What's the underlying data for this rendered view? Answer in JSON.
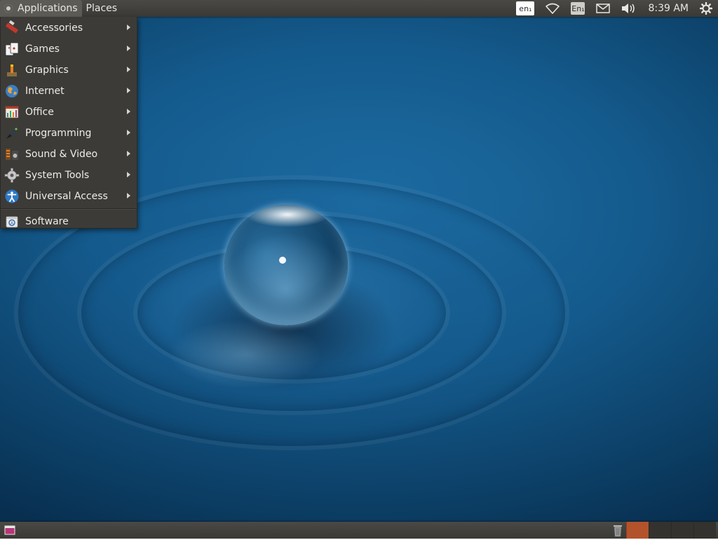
{
  "top_panel": {
    "menus": [
      {
        "label": "Applications",
        "active": true
      },
      {
        "label": "Places",
        "active": false
      }
    ],
    "tray": {
      "keyboard_layout": "en₁",
      "input_method": "En₁",
      "clock": "8:39 AM",
      "icons": [
        "network-wireless-icon",
        "mail-icon",
        "volume-icon",
        "power-gear-icon"
      ]
    }
  },
  "applications_menu": {
    "items": [
      {
        "label": "Accessories",
        "icon": "accessories-icon",
        "submenu": true
      },
      {
        "label": "Games",
        "icon": "games-icon",
        "submenu": true
      },
      {
        "label": "Graphics",
        "icon": "graphics-icon",
        "submenu": true
      },
      {
        "label": "Internet",
        "icon": "internet-globe-icon",
        "submenu": true
      },
      {
        "label": "Office",
        "icon": "office-icon",
        "submenu": true
      },
      {
        "label": "Programming",
        "icon": "programming-icon",
        "submenu": true
      },
      {
        "label": "Sound & Video",
        "icon": "sound-video-icon",
        "submenu": true
      },
      {
        "label": "System Tools",
        "icon": "system-tools-gear-icon",
        "submenu": true
      },
      {
        "label": "Universal Access",
        "icon": "universal-access-icon",
        "submenu": true
      }
    ],
    "footer_item": {
      "label": "Software",
      "icon": "software-center-icon"
    }
  },
  "bottom_panel": {
    "icons": [
      "show-desktop-icon",
      "trash-icon"
    ],
    "workspaces": {
      "count": 4,
      "active_index": 0
    }
  },
  "colors": {
    "panel": "#3c3b37",
    "menu_bg": "#3c3b37",
    "active_workspace": "#b3532c",
    "wallpaper_blue": "#145a8c"
  }
}
